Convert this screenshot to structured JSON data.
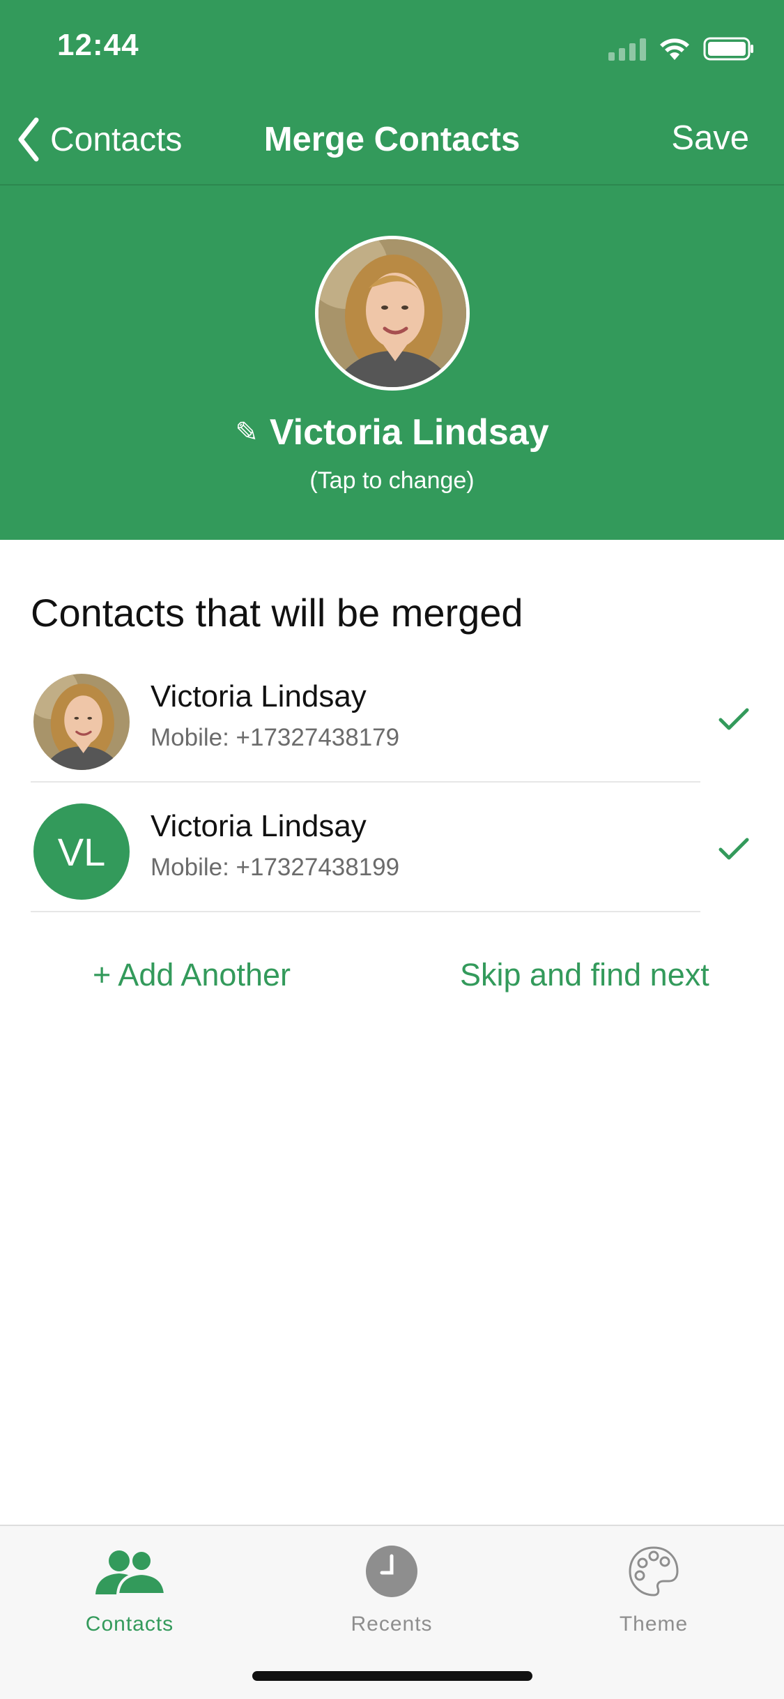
{
  "status_bar": {
    "time": "12:44"
  },
  "nav": {
    "back_label": "Contacts",
    "title": "Merge Contacts",
    "save_label": "Save"
  },
  "hero": {
    "name": "Victoria Lindsay",
    "subtitle": "(Tap to change)"
  },
  "section_title": "Contacts that will be merged",
  "contacts": [
    {
      "name": "Victoria Lindsay",
      "phone": "Mobile: +17327438179",
      "avatar": "photo",
      "checked": true
    },
    {
      "name": "Victoria Lindsay",
      "phone": "Mobile: +17327438199",
      "avatar": "initials",
      "initials": "VL",
      "checked": true
    }
  ],
  "actions": {
    "add_another": "+ Add Another",
    "skip": "Skip and find next"
  },
  "tabs": [
    {
      "label": "Contacts",
      "icon": "contacts-icon",
      "active": true
    },
    {
      "label": "Recents",
      "icon": "clock-icon",
      "active": false
    },
    {
      "label": "Theme",
      "icon": "palette-icon",
      "active": false
    }
  ],
  "colors": {
    "accent": "#339a5b",
    "inactive": "#8e8e8e",
    "secondary_text": "#6b6b6b"
  }
}
